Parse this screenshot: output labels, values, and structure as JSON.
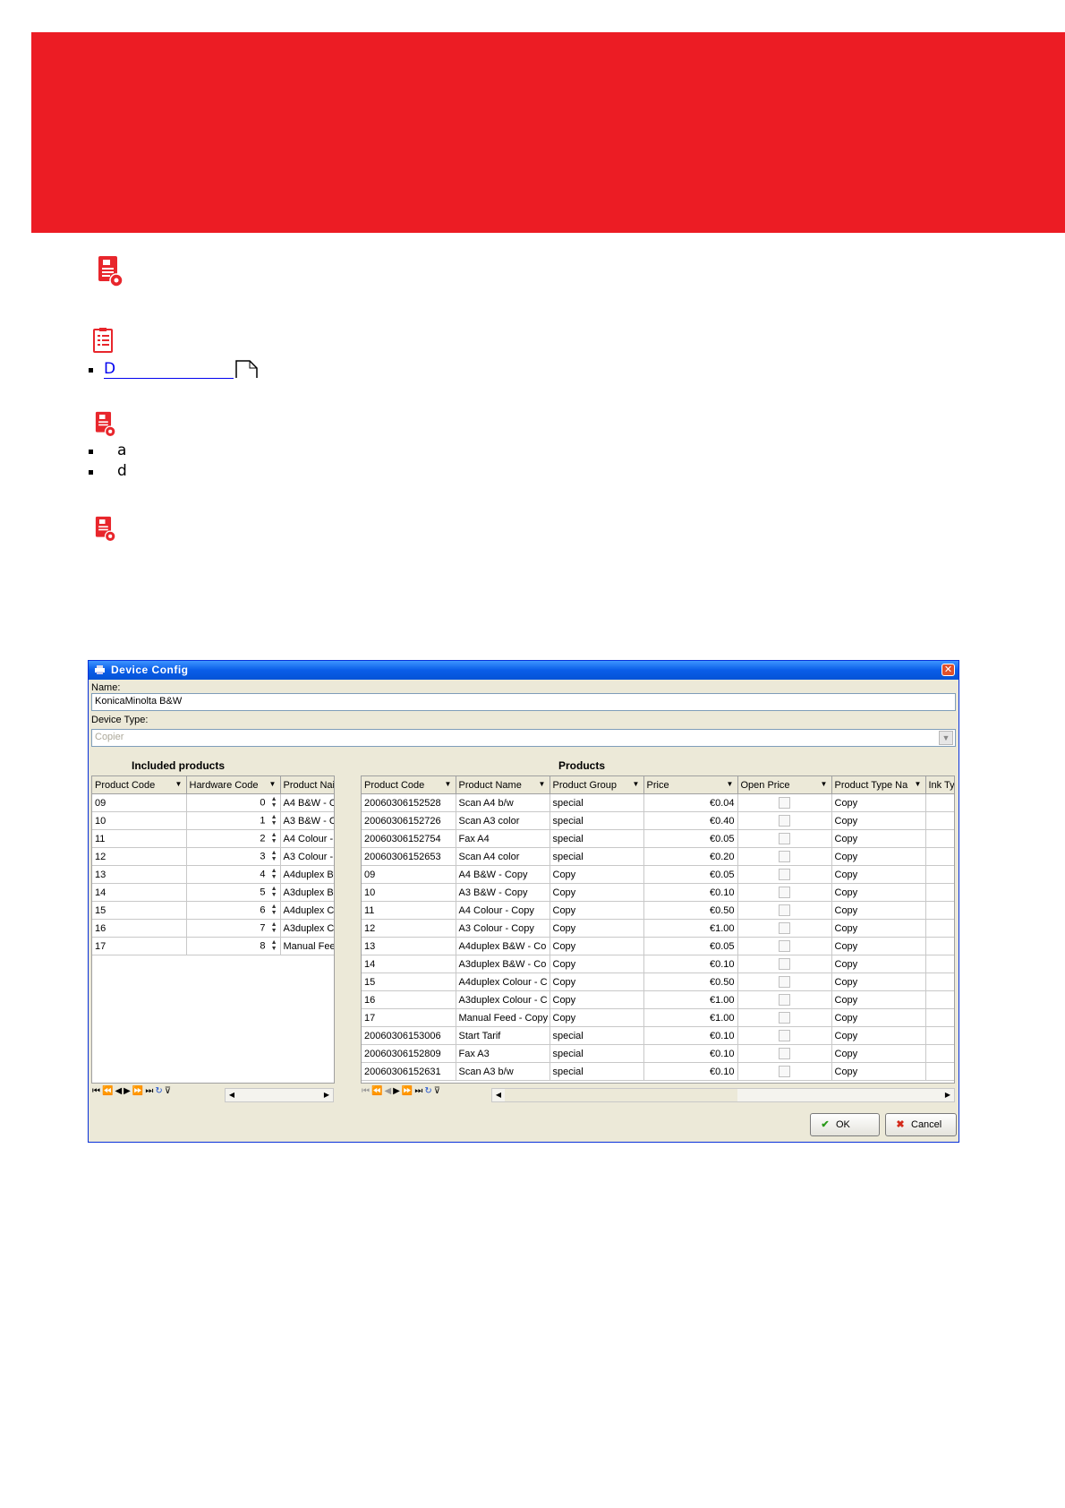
{
  "doc": {
    "link_text": "D",
    "bullets": [
      "a",
      "d"
    ]
  },
  "dialog": {
    "title": "Device Config",
    "name_label": "Name:",
    "name_value": "KonicaMinolta B&W",
    "type_label": "Device Type:",
    "type_value": "Copier",
    "included_title": "Included products",
    "products_title": "Products",
    "included_columns": [
      "Product Code",
      "Hardware Code",
      "Product Nai"
    ],
    "included_rows": [
      [
        "09",
        "0",
        "A4 B&W - C"
      ],
      [
        "10",
        "1",
        "A3 B&W - C"
      ],
      [
        "11",
        "2",
        "A4 Colour -"
      ],
      [
        "12",
        "3",
        "A3 Colour -"
      ],
      [
        "13",
        "4",
        "A4duplex B"
      ],
      [
        "14",
        "5",
        "A3duplex B"
      ],
      [
        "15",
        "6",
        "A4duplex C"
      ],
      [
        "16",
        "7",
        "A3duplex C"
      ],
      [
        "17",
        "8",
        "Manual Fee"
      ]
    ],
    "products_columns": [
      "Product Code",
      "Product Name",
      "Product Group",
      "Price",
      "Open Price",
      "Product Type Na",
      "Ink Typ"
    ],
    "products_rows": [
      [
        "20060306152528",
        "Scan A4 b/w",
        "special",
        "€0.04",
        "Copy"
      ],
      [
        "20060306152726",
        "Scan A3 color",
        "special",
        "€0.40",
        "Copy"
      ],
      [
        "20060306152754",
        "Fax A4",
        "special",
        "€0.05",
        "Copy"
      ],
      [
        "20060306152653",
        "Scan A4 color",
        "special",
        "€0.20",
        "Copy"
      ],
      [
        "09",
        "A4 B&W - Copy",
        "Copy",
        "€0.05",
        "Copy"
      ],
      [
        "10",
        "A3 B&W - Copy",
        "Copy",
        "€0.10",
        "Copy"
      ],
      [
        "11",
        "A4 Colour - Copy",
        "Copy",
        "€0.50",
        "Copy"
      ],
      [
        "12",
        "A3 Colour - Copy",
        "Copy",
        "€1.00",
        "Copy"
      ],
      [
        "13",
        "A4duplex B&W - Co",
        "Copy",
        "€0.05",
        "Copy"
      ],
      [
        "14",
        "A3duplex B&W - Co",
        "Copy",
        "€0.10",
        "Copy"
      ],
      [
        "15",
        "A4duplex Colour - C",
        "Copy",
        "€0.50",
        "Copy"
      ],
      [
        "16",
        "A3duplex Colour - C",
        "Copy",
        "€1.00",
        "Copy"
      ],
      [
        "17",
        "Manual Feed - Copy",
        "Copy",
        "€1.00",
        "Copy"
      ],
      [
        "20060306153006",
        "Start Tarif",
        "special",
        "€0.10",
        "Copy"
      ],
      [
        "20060306152809",
        "Fax A3",
        "special",
        "€0.10",
        "Copy"
      ],
      [
        "20060306152631",
        "Scan A3 b/w",
        "special",
        "€0.10",
        "Copy"
      ]
    ],
    "ok_label": "OK",
    "cancel_label": "Cancel"
  },
  "colors": {
    "header_red": "#ec1c24",
    "titlebar_blue": "#0a5de8"
  },
  "icons": [
    "settings-document-icon",
    "clipboard-icon",
    "page-icon",
    "move-left-icon",
    "move-right-icon",
    "move-all-left-icon",
    "move-all-right-icon",
    "ok-check-icon",
    "cancel-x-icon"
  ]
}
